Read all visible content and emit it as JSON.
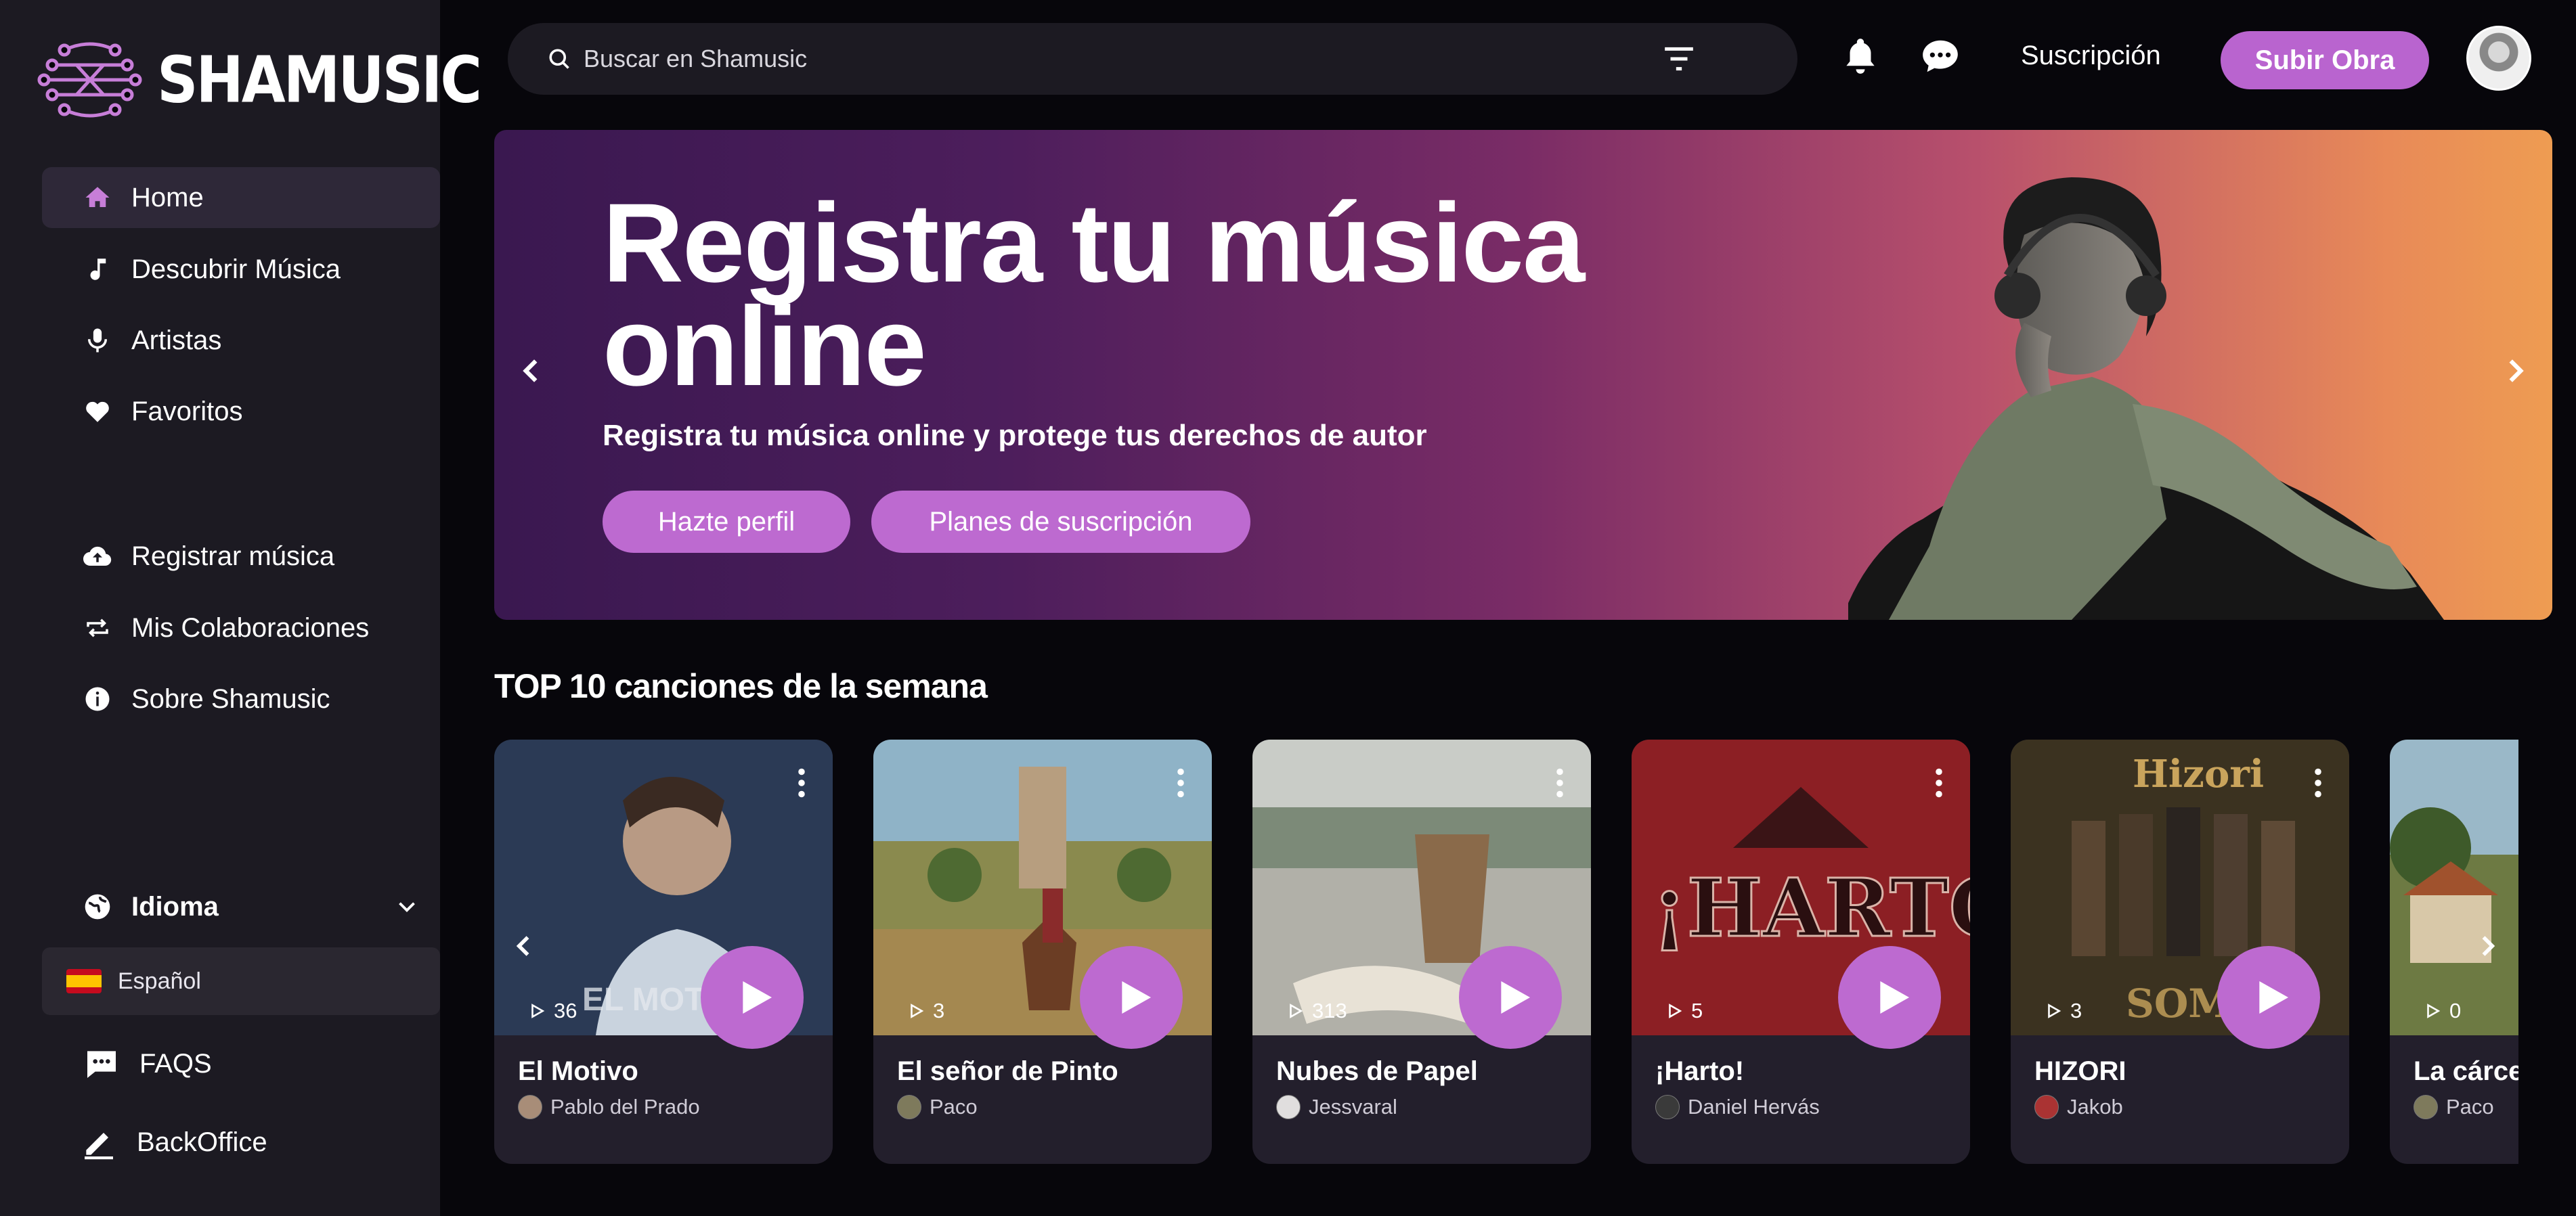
{
  "brand": {
    "name": "SHAMUSIC",
    "accent": "#b964cf",
    "logo_icon": "circuit-waves-logo"
  },
  "sidebar": {
    "items": [
      {
        "label": "Home",
        "icon": "home-icon",
        "active": true
      },
      {
        "label": "Descubrir Música",
        "icon": "music-note-icon"
      },
      {
        "label": "Artistas",
        "icon": "microphone-icon"
      },
      {
        "label": "Favoritos",
        "icon": "heart-icon"
      },
      {
        "label": "Registrar música",
        "icon": "cloud-upload-icon"
      },
      {
        "label": "Mis Colaboraciones",
        "icon": "repeat-icon"
      },
      {
        "label": "Sobre Shamusic",
        "icon": "info-icon"
      }
    ],
    "language": {
      "label": "Idioma",
      "selected": "Español"
    },
    "faqs": "FAQS",
    "backoffice": "BackOffice"
  },
  "header": {
    "search_placeholder": "Buscar en Shamusic",
    "subscription_link": "Suscripción",
    "upload_button": "Subir Obra"
  },
  "hero": {
    "title": "Registra tu música online",
    "subtitle": "Registra tu música online y protege tus derechos de autor",
    "primary_button": "Hazte perfil",
    "secondary_button": "Planes de suscripción"
  },
  "top10": {
    "title": "TOP 10 canciones de la semana",
    "songs": [
      {
        "title": "El Motivo",
        "artist": "Pablo del Prado",
        "plays": "36"
      },
      {
        "title": "El señor de Pinto",
        "artist": "Paco",
        "plays": "3"
      },
      {
        "title": "Nubes de Papel",
        "artist": "Jessvaral",
        "plays": "313"
      },
      {
        "title": "¡Harto!",
        "artist": "Daniel Hervás",
        "plays": "5"
      },
      {
        "title": "HIZORI",
        "artist": "Jakob",
        "plays": "3"
      },
      {
        "title": "La cárcel",
        "artist": "Paco",
        "plays": "0"
      }
    ]
  }
}
